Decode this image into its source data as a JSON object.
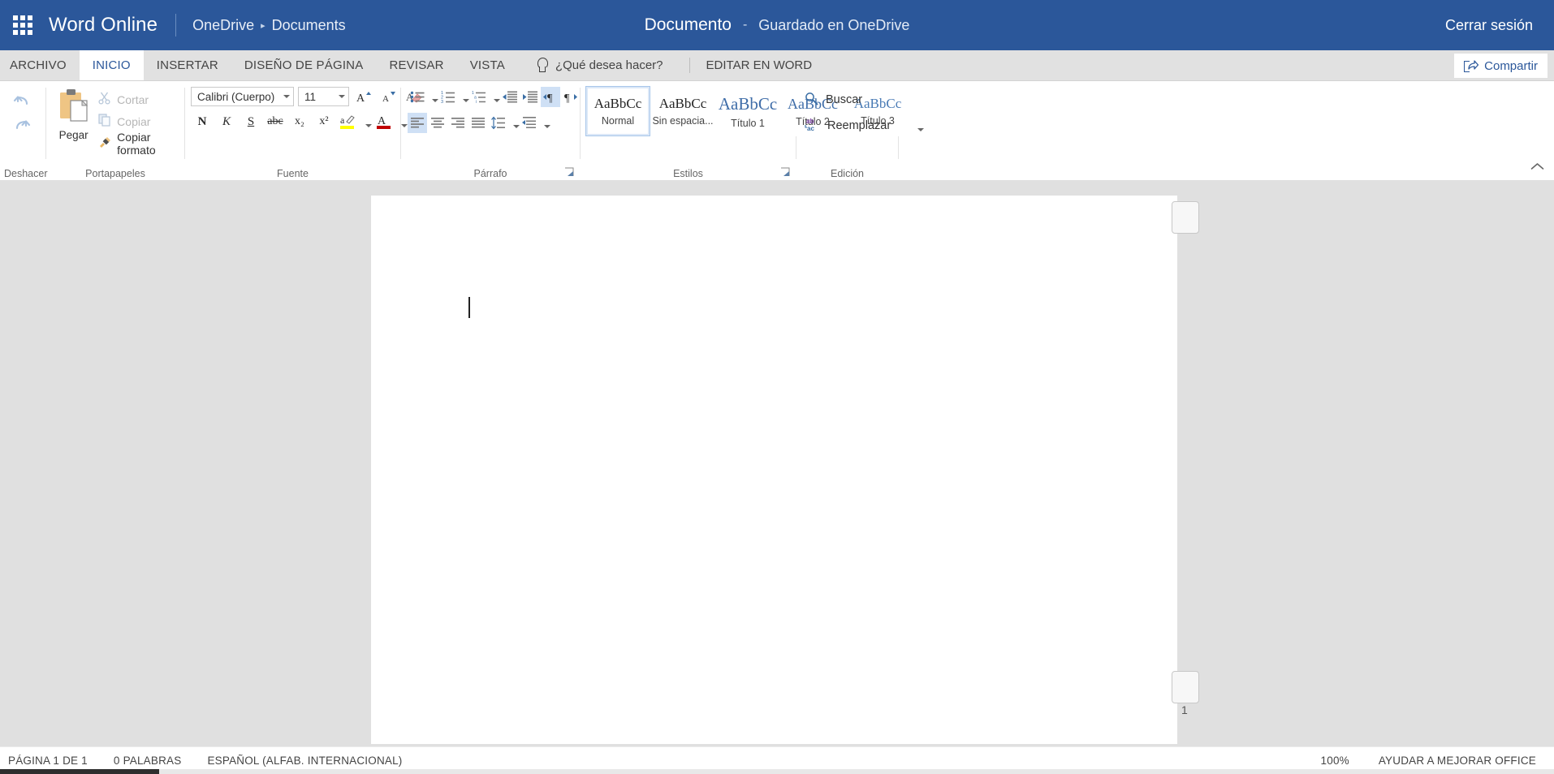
{
  "suitebar": {
    "waffle_label": "app-launcher",
    "app_name": "Word Online",
    "breadcrumb_root": "OneDrive",
    "breadcrumb_sep": "▸",
    "breadcrumb_current": "Documents",
    "doc_title": "Documento",
    "doc_dash": "-",
    "doc_saved": "Guardado en OneDrive",
    "signout": "Cerrar sesión",
    "bg_color": "#2b579a"
  },
  "tabs": [
    {
      "label": "ARCHIVO",
      "active": false
    },
    {
      "label": "INICIO",
      "active": true
    },
    {
      "label": "INSERTAR",
      "active": false
    },
    {
      "label": "DISEÑO DE PÁGINA",
      "active": false
    },
    {
      "label": "REVISAR",
      "active": false
    },
    {
      "label": "VISTA",
      "active": false
    }
  ],
  "tellme": {
    "placeholder": "¿Qué desea hacer?",
    "icon": "lightbulb-icon"
  },
  "edit_in_word": "EDITAR EN WORD",
  "share": {
    "label": "Compartir",
    "icon": "share-icon"
  },
  "ribbon": {
    "undo": {
      "group_label": "Deshacer",
      "undo_tooltip": "Deshacer",
      "redo_tooltip": "Rehacer"
    },
    "clipboard": {
      "group_label": "Portapapeles",
      "paste_label": "Pegar",
      "items": [
        {
          "label": "Cortar",
          "icon": "scissors-icon",
          "enabled": false
        },
        {
          "label": "Copiar",
          "icon": "copy-icon",
          "enabled": false
        },
        {
          "label": "Copiar formato",
          "icon": "format-painter-icon",
          "enabled": true
        }
      ]
    },
    "font": {
      "group_label": "Fuente",
      "font_family_value": "Calibri (Cuerpo)",
      "font_size_value": "11",
      "grow_font": "A▴",
      "shrink_font": "A▾",
      "clear_format": "clear-formatting-icon",
      "bold": "N",
      "italic": "K",
      "underline": "S",
      "strikethrough": "abc",
      "subscript": "x₂",
      "superscript": "x²",
      "highlight": "a",
      "font_color": "A"
    },
    "paragraph": {
      "group_label": "Párrafo",
      "bullets": "bullet-list-icon",
      "numbering": "numbered-list-icon",
      "multilevel": "multilevel-list-icon",
      "decrease_indent": "decrease-indent-icon",
      "increase_indent": "increase-indent-icon",
      "ltr": "left-to-right-icon",
      "rtl": "right-to-left-icon",
      "align_left": "align-left-icon",
      "align_center": "align-center-icon",
      "align_right": "align-right-icon",
      "justify": "justify-icon",
      "line_spacing": "line-spacing-icon",
      "paragraph_spacing": "paragraph-spacing-icon"
    },
    "styles": {
      "group_label": "Estilos",
      "items": [
        {
          "preview": "AaBbCc",
          "name": "Normal",
          "selected": true,
          "size": 17,
          "color": "#262626"
        },
        {
          "preview": "AaBbCc",
          "name": "Sin espacia...",
          "selected": false,
          "size": 17,
          "color": "#262626"
        },
        {
          "preview": "AaBbCc",
          "name": "Título 1",
          "selected": false,
          "size": 21,
          "color": "#3f6da8"
        },
        {
          "preview": "AaBbCc",
          "name": "Título 2",
          "selected": false,
          "size": 18,
          "color": "#3f6da8"
        },
        {
          "preview": "AaBbCc",
          "name": "Título 3",
          "selected": false,
          "size": 17,
          "color": "#4a7bb5"
        }
      ]
    },
    "editing": {
      "group_label": "Edición",
      "find_label": "Buscar",
      "find_icon": "search-icon",
      "replace_label": "Reemplazar",
      "replace_icon": "replace-icon"
    },
    "collapse_icon": "chevron-up-icon"
  },
  "document": {
    "page_number": "1",
    "comment_anchor_top": "comment-box",
    "comment_anchor_bottom": "comment-box"
  },
  "statusbar": {
    "page_info": "PÁGINA 1 DE 1",
    "word_count": "0 PALABRAS",
    "language": "ESPAÑOL (ALFAB. INTERNACIONAL)",
    "zoom": "100%",
    "feedback": "AYUDAR A MEJORAR OFFICE"
  }
}
